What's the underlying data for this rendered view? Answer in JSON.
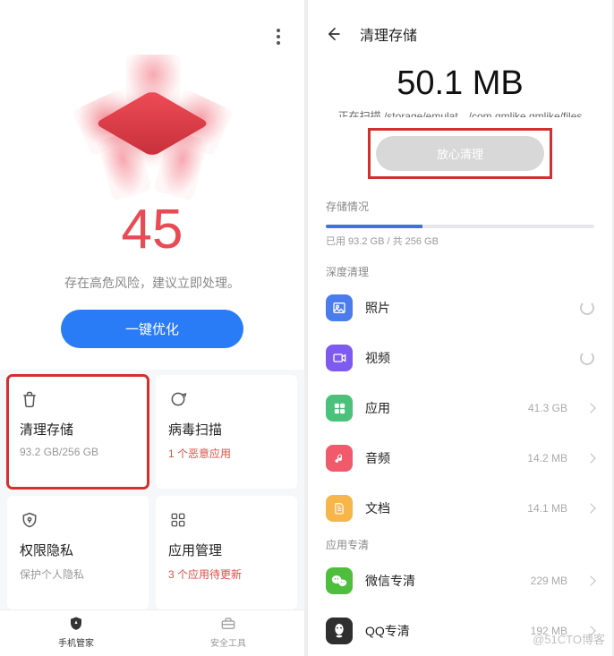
{
  "left": {
    "score": "45",
    "risk_text": "存在高危风险，建议立即处理。",
    "optimize_label": "一键优化",
    "cards": {
      "storage": {
        "title": "清理存储",
        "sub": "93.2 GB/256 GB"
      },
      "virus": {
        "title": "病毒扫描",
        "sub": "1 个恶意应用"
      },
      "privacy": {
        "title": "权限隐私",
        "sub": "保护个人隐私"
      },
      "apps": {
        "title": "应用管理",
        "sub": "3 个应用待更新"
      }
    },
    "bottom_bar": {
      "manager": "手机管家",
      "tools": "安全工具"
    }
  },
  "right": {
    "title": "清理存储",
    "scan_size": "50.1 MB",
    "scan_prefix": "正在扫描 ",
    "scan_path": "/storage/emulat…/com.qmlike.qmlike/files",
    "clean_button": "放心清理",
    "section_storage": "存储情况",
    "storage_used_pct": 36,
    "storage_text": "已用 93.2 GB / 共 256 GB",
    "section_deep": "深度清理",
    "deep_items": [
      {
        "name": "照片",
        "value": "",
        "spinner": true,
        "color": "#4a7ced",
        "icon": "photo"
      },
      {
        "name": "视频",
        "value": "",
        "spinner": true,
        "color": "#7f5af0",
        "icon": "video"
      },
      {
        "name": "应用",
        "value": "41.3 GB",
        "spinner": false,
        "color": "#4ac27b",
        "icon": "apps"
      },
      {
        "name": "音频",
        "value": "14.2 MB",
        "spinner": false,
        "color": "#f05a6a",
        "icon": "audio"
      },
      {
        "name": "文档",
        "value": "14.1 MB",
        "spinner": false,
        "color": "#f6b64a",
        "icon": "doc"
      }
    ],
    "section_app": "应用专清",
    "app_items": [
      {
        "name": "微信专清",
        "value": "229 MB",
        "color": "#4fbe3d",
        "icon": "wechat"
      },
      {
        "name": "QQ专清",
        "value": "192 MB",
        "color": "#2f2f2f",
        "icon": "qq"
      }
    ]
  },
  "watermark": "@51CTO博客"
}
